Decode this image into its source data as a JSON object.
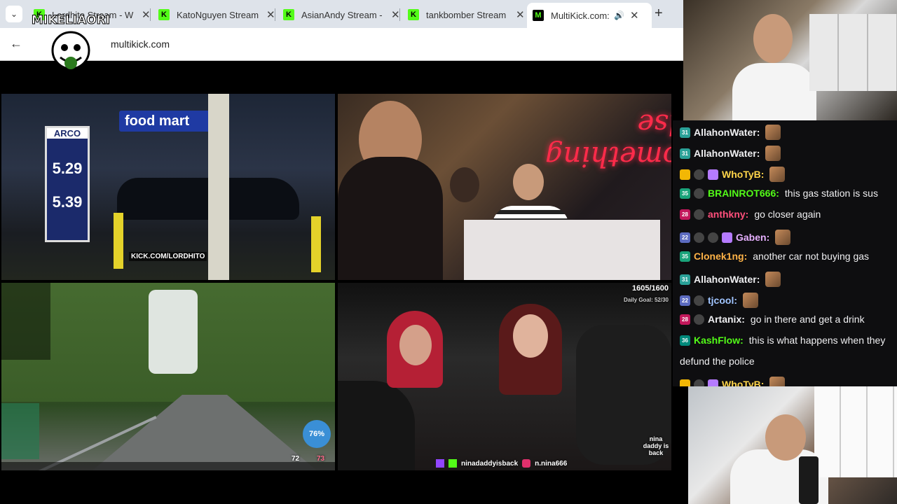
{
  "tabs": [
    {
      "label": "Lordhito Stream - W",
      "active": false
    },
    {
      "label": "KatoNguyen Stream",
      "active": false
    },
    {
      "label": "AsianAndy Stream -",
      "active": false
    },
    {
      "label": "tankbomber Stream",
      "active": false
    },
    {
      "label": "MultiKick.com: W",
      "active": true
    }
  ],
  "address": {
    "url": "multikick.com"
  },
  "logo_text": "MIKELIAORI",
  "tiles": {
    "t1": {
      "overlay": "KICK.COM/LORDHITO",
      "sign": "food mart",
      "brand": "ARCO",
      "price1": "5.29",
      "price2": "5.39"
    },
    "t2": {
      "neon": "something else"
    },
    "t3": {
      "speed": "76%",
      "views": "72",
      "likes": "73"
    },
    "t4": {
      "counter": "1605/1600",
      "goal": "Daily Goal: 52/30",
      "handle": "ninadaddyisback",
      "ig": "n.nina666",
      "logo": "nina daddy is back"
    }
  },
  "chat": [
    {
      "badges": [
        "31"
      ],
      "user": "AllahonWater:",
      "color": "#efeff1",
      "msg": "",
      "emote": true
    },
    {
      "badges": [
        "31"
      ],
      "user": "AllahonWater:",
      "color": "#efeff1",
      "msg": "",
      "emote": true
    },
    {
      "badges": [
        "crown",
        "face",
        "gift"
      ],
      "user": "WhoTyB:",
      "color": "#ffd54a",
      "msg": "",
      "emote": true
    },
    {
      "badges": [
        "35",
        "face"
      ],
      "user": "BRAINROT666:",
      "color": "#53fc18",
      "msg": "this gas station is sus",
      "emote": false
    },
    {
      "badges": [
        "28",
        "face"
      ],
      "user": "anthkny:",
      "color": "#ff4f7b",
      "msg": "go closer again",
      "emote": false
    },
    {
      "badges": [
        "22",
        "face",
        "face",
        "gift"
      ],
      "user": "Gaben:",
      "color": "#e6b0ff",
      "msg": "",
      "emote": true
    },
    {
      "badges": [
        "35"
      ],
      "user": "Clonek1ng:",
      "color": "#ffb347",
      "msg": "another car not buying gas",
      "emote": false
    },
    {
      "badges": [
        "31"
      ],
      "user": "AllahonWater:",
      "color": "#efeff1",
      "msg": "",
      "emote": true
    },
    {
      "badges": [
        "22",
        "face"
      ],
      "user": "tjcool:",
      "color": "#a0c4ff",
      "msg": "",
      "emote": true
    },
    {
      "badges": [
        "28",
        "face"
      ],
      "user": "Artanix:",
      "color": "#efeff1",
      "msg": "go in there and get a drink",
      "emote": false
    },
    {
      "badges": [
        "36"
      ],
      "user": "KashFlow:",
      "color": "#53fc18",
      "msg": "this is what happens when they",
      "emote": false
    },
    {
      "badges": [],
      "user": "",
      "color": "#efeff1",
      "msg": "defund the police",
      "emote": false
    },
    {
      "badges": [
        "crown",
        "face",
        "gift"
      ],
      "user": "WhoTyB:",
      "color": "#ffd54a",
      "msg": "",
      "emote": true
    }
  ],
  "colors": {
    "kick_green": "#53fc18",
    "chat_bg": "#0e0e10"
  }
}
